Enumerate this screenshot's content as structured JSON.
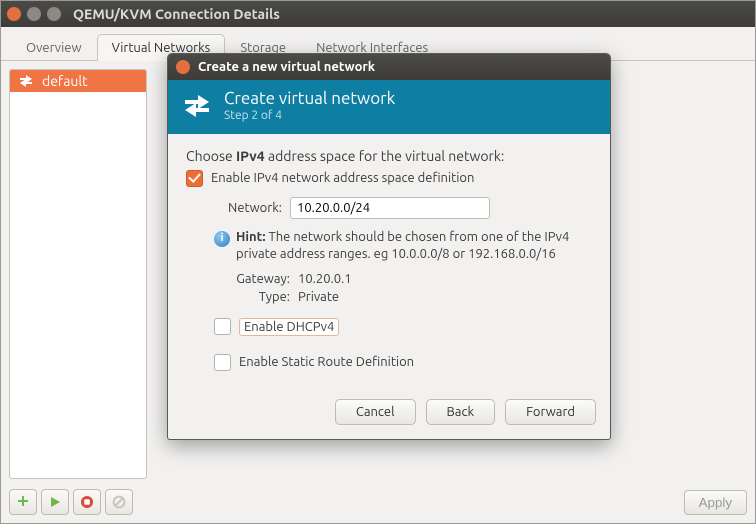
{
  "parent": {
    "title": "QEMU/KVM Connection Details",
    "tabs": [
      "Overview",
      "Virtual Networks",
      "Storage",
      "Network Interfaces"
    ],
    "active_tab": 1,
    "list_item": "default",
    "apply_label": "Apply"
  },
  "dialog": {
    "window_title": "Create a new virtual network",
    "header_title": "Create virtual network",
    "header_step": "Step 2 of 4",
    "choose_prefix": "Choose ",
    "choose_bold": "IPv4",
    "choose_suffix": " address space for the virtual network:",
    "enable_ipv4_label": "Enable IPv4 network address space definition",
    "network_label": "Network:",
    "network_value": "10.20.0.0/24",
    "hint_bold": "Hint:",
    "hint_text": " The network should be chosen from one of the IPv4 private address ranges. eg 10.0.0.0/8 or 192.168.0.0/16",
    "gateway_label": "Gateway:",
    "gateway_value": "10.20.0.1",
    "type_label": "Type:",
    "type_value": "Private",
    "enable_dhcp_label": "Enable DHCPv4",
    "enable_static_label": "Enable Static Route Definition",
    "buttons": {
      "cancel": "Cancel",
      "back": "Back",
      "forward": "Forward"
    }
  }
}
